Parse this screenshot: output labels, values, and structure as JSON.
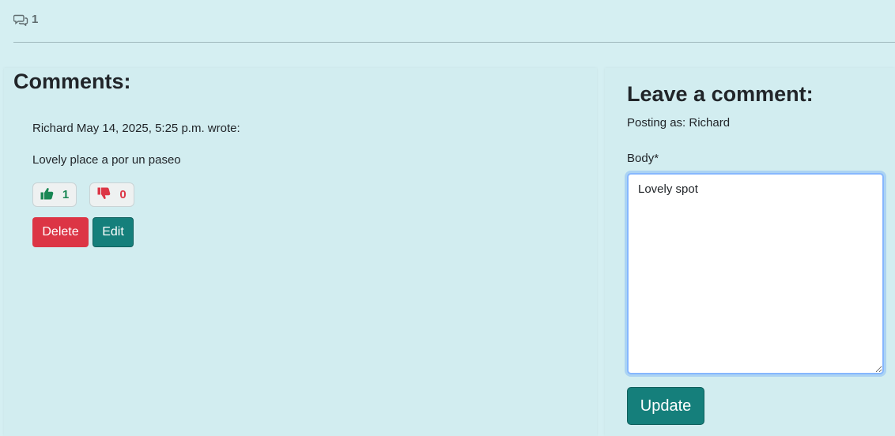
{
  "header": {
    "comment_count": "1",
    "comment_count_icon": "chat-bubbles-icon"
  },
  "comments_section": {
    "heading": "Comments:",
    "comments": [
      {
        "meta": "Richard May 14, 2025, 5:25 p.m. wrote:",
        "body": "Lovely place a por un paseo",
        "likes": "1",
        "dislikes": "0",
        "delete_label": "Delete",
        "edit_label": "Edit"
      }
    ]
  },
  "comment_form": {
    "heading": "Leave a comment:",
    "posting_as": "Posting as: Richard",
    "body_label": "Body*",
    "body_value": "Lovely spot",
    "submit_label": "Update"
  },
  "colors": {
    "background": "#d5eff2",
    "like": "#198754",
    "dislike": "#dc3545",
    "delete": "#dc3545",
    "primary_teal": "#157f7b"
  }
}
